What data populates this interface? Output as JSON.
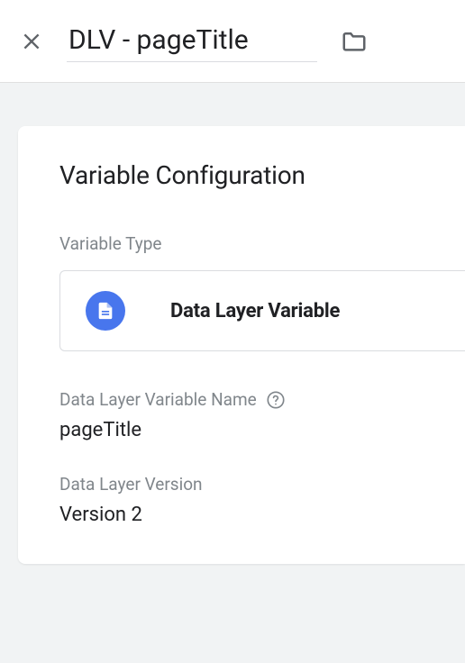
{
  "header": {
    "title": "DLV - pageTitle"
  },
  "card": {
    "title": "Variable Configuration",
    "type_label": "Variable Type",
    "type_value": "Data Layer Variable",
    "name_label": "Data Layer Variable Name",
    "name_value": "pageTitle",
    "version_label": "Data Layer Version",
    "version_value": "Version 2"
  }
}
